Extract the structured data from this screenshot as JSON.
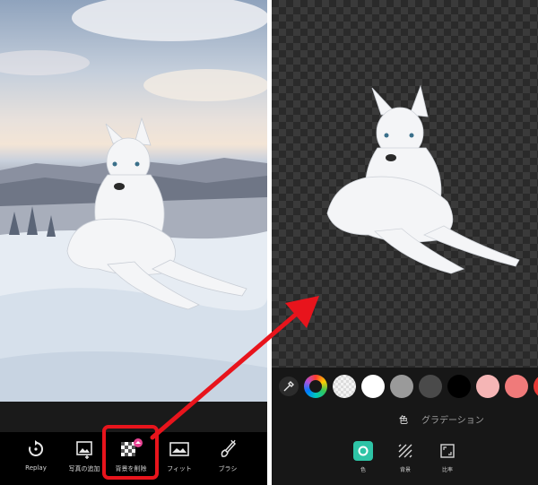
{
  "left_panel": {
    "toolbar": [
      {
        "label": "Replay",
        "icon": "replay-icon"
      },
      {
        "label": "写真の追加",
        "icon": "add-photo-icon"
      },
      {
        "label": "背景を削除",
        "icon": "remove-background-icon"
      },
      {
        "label": "フィット",
        "icon": "fit-icon"
      },
      {
        "label": "ブラシ",
        "icon": "brush-icon"
      }
    ]
  },
  "right_panel": {
    "color_swatches": [
      "#ffffff",
      "#f2f2f2",
      "#9a9a9a",
      "#4a4a4a",
      "#000000",
      "#f5b5b5",
      "#f07a7a",
      "#e53935"
    ],
    "mode_tabs": {
      "color": "色",
      "gradient": "グラデーション"
    },
    "bottom_tabs": [
      {
        "label": "色",
        "icon": "color-fill-icon"
      },
      {
        "label": "背景",
        "icon": "pattern-icon"
      },
      {
        "label": "比率",
        "icon": "ratio-icon"
      }
    ]
  },
  "colors": {
    "highlight": "#e8141c",
    "accent": "#2ec4a6"
  }
}
